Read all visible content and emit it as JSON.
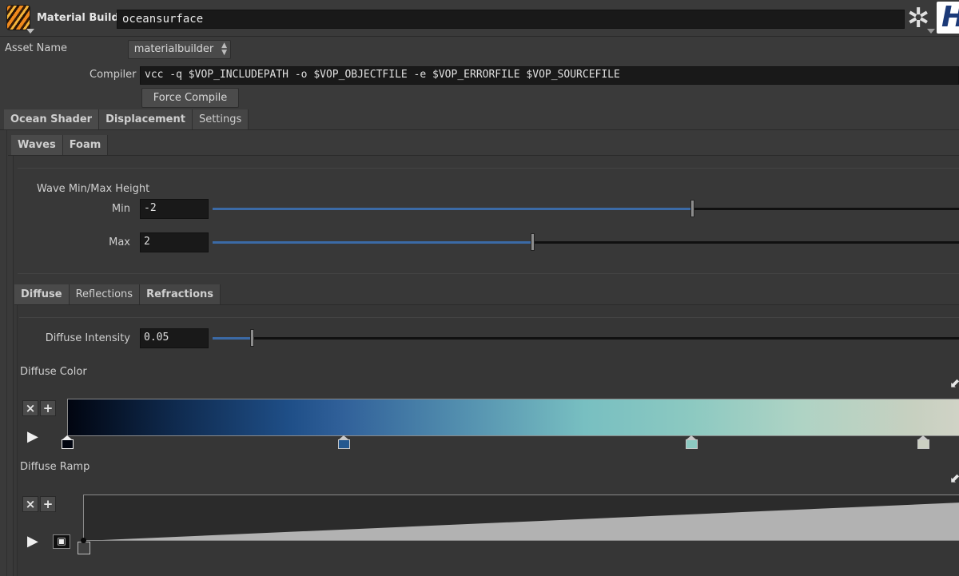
{
  "header": {
    "node_type": "Material Builder",
    "node_name": "oceansurface",
    "logo_text": "H"
  },
  "asset": {
    "label": "Asset Name",
    "value": "materialbuilder"
  },
  "compiler": {
    "label": "Compiler",
    "value": "vcc -q $VOP_INCLUDEPATH -o $VOP_OBJECTFILE -e $VOP_ERRORFILE $VOP_SOURCEFILE",
    "force_compile_label": "Force Compile"
  },
  "tabs_main": [
    "Ocean Shader",
    "Displacement",
    "Settings"
  ],
  "tabs_sub": [
    "Waves",
    "Foam"
  ],
  "waves": {
    "group_label": "Wave Min/Max Height",
    "min_label": "Min",
    "min_value": "-2",
    "min_slider_fraction": 0.5,
    "max_label": "Max",
    "max_value": "2",
    "max_slider_fraction": 0.5
  },
  "tabs_shading": [
    "Diffuse",
    "Reflections",
    "Refractions"
  ],
  "diffuse": {
    "intensity_label": "Diffuse Intensity",
    "intensity_value": "0.05",
    "intensity_slider_fraction": 0.05,
    "color_label": "Diffuse Color",
    "color_ramp_keys": [
      {
        "pos": 0.0,
        "color": "#010510"
      },
      {
        "pos": 0.31,
        "color": "#24588f"
      },
      {
        "pos": 0.7,
        "color": "#8cc9c1"
      },
      {
        "pos": 0.96,
        "color": "#ccd0c2"
      }
    ],
    "ramp_label": "Diffuse Ramp",
    "ramp_keys": [
      {
        "pos": 0.0,
        "value": 0.0
      },
      {
        "pos": 1.0,
        "value": 0.9
      }
    ]
  },
  "icons": {
    "remove": "×",
    "add": "+",
    "play": "▶",
    "gear": "✲",
    "expand": "⬋",
    "interp": "▣"
  }
}
